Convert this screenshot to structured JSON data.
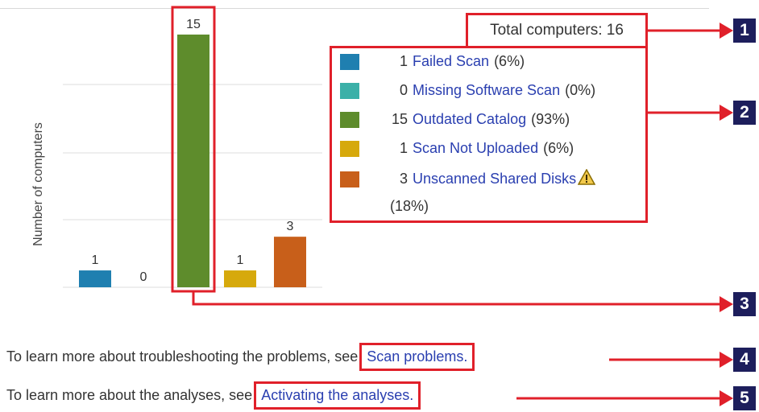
{
  "total": {
    "label": "Total computers: 16"
  },
  "chart_data": {
    "type": "bar",
    "ylabel": "Number of computers",
    "categories": [
      "Failed Scan",
      "Missing Software Scan",
      "Outdated Catalog",
      "Scan Not Uploaded",
      "Unscanned Shared Disks"
    ],
    "values": [
      1,
      0,
      15,
      1,
      3
    ],
    "colors": [
      "#1f7fb0",
      "#3bb0a8",
      "#5e8c2c",
      "#d6a90c",
      "#c85f1a"
    ],
    "ylim": [
      0,
      16
    ],
    "grid": true
  },
  "legend": [
    {
      "count": "1",
      "label": "Failed Scan",
      "pct": "(6%)",
      "color": "#1f7fb0"
    },
    {
      "count": "0",
      "label": "Missing Software Scan",
      "pct": "(0%)",
      "color": "#3bb0a8"
    },
    {
      "count": "15",
      "label": "Outdated Catalog",
      "pct": "(93%)",
      "color": "#5e8c2c"
    },
    {
      "count": "1",
      "label": "Scan Not Uploaded",
      "pct": "(6%)",
      "color": "#d6a90c"
    },
    {
      "count": "3",
      "label": "Unscanned Shared Disks",
      "pct": "(18%)",
      "color": "#c85f1a",
      "icon": "warning-icon"
    }
  ],
  "footer": {
    "line1_text": "To learn more about troubleshooting the problems, see",
    "line1_link": "Scan problems.",
    "line2_text": "To learn more about the analyses, see",
    "line2_link": "Activating the analyses."
  },
  "callouts": [
    "1",
    "2",
    "3",
    "4",
    "5"
  ],
  "accent_color": "#e0202a",
  "badge_color": "#1d1e5c"
}
